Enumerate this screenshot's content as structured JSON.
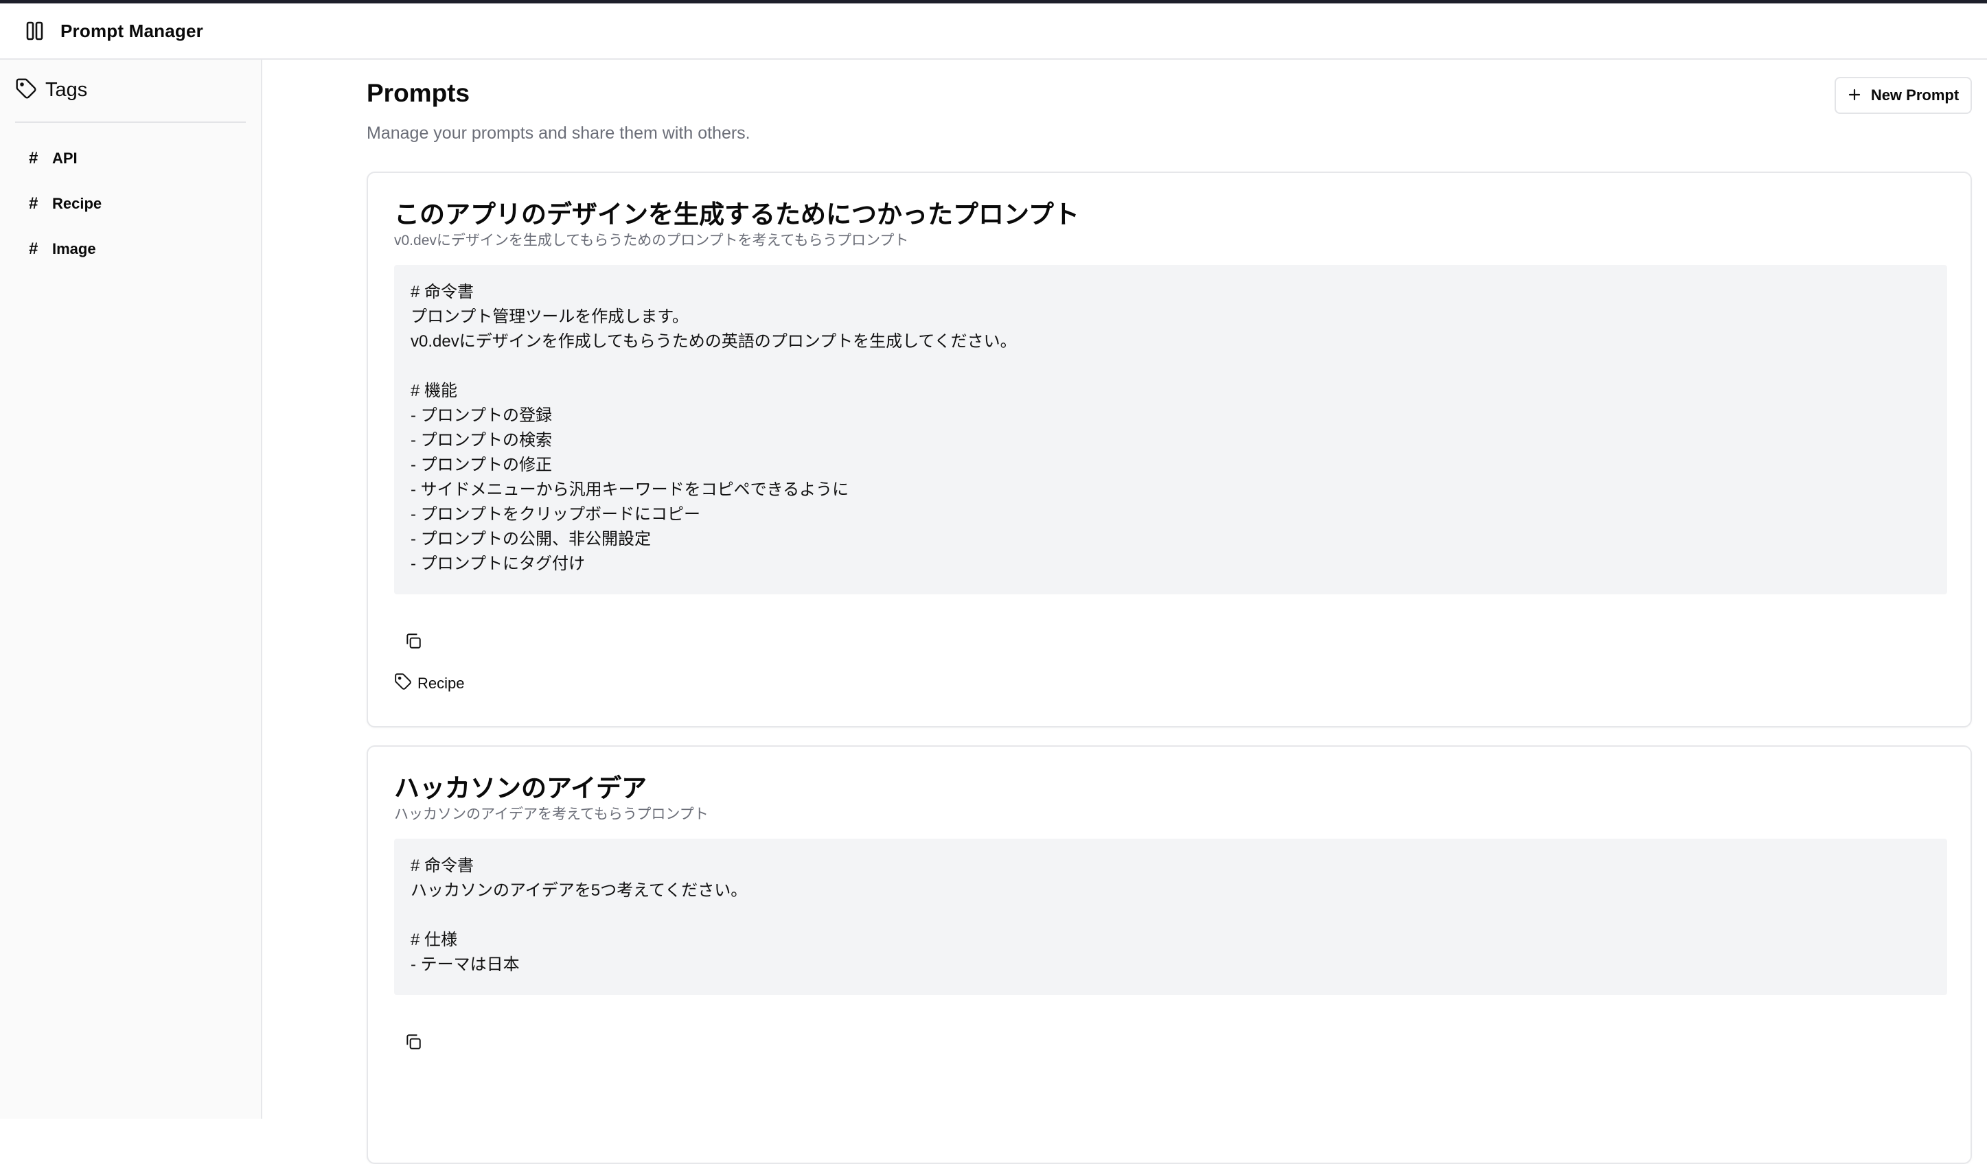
{
  "app": {
    "title": "Prompt Manager"
  },
  "sidebar": {
    "heading": "Tags",
    "items": [
      {
        "hash": "#",
        "label": "API"
      },
      {
        "hash": "#",
        "label": "Recipe"
      },
      {
        "hash": "#",
        "label": "Image"
      }
    ]
  },
  "main": {
    "title": "Prompts",
    "subtitle": "Manage your prompts and share them with others.",
    "new_button": {
      "icon": "plus-icon",
      "label": "New Prompt"
    }
  },
  "prompts": [
    {
      "title": "このアプリのデザインを生成するためにつかったプロンプト",
      "description": "v0.devにデザインを生成してもらうためのプロンプトを考えてもらうプロンプト",
      "body": "# 命令書\nプロンプト管理ツールを作成します。\nv0.devにデザインを作成してもらうための英語のプロンプトを生成してください。\n\n# 機能\n- プロンプトの登録\n- プロンプトの検索\n- プロンプトの修正\n- サイドメニューから汎用キーワードをコピペできるように\n- プロンプトをクリップボードにコピー\n- プロンプトの公開、非公開設定\n- プロンプトにタグ付け",
      "tag": "Recipe"
    },
    {
      "title": "ハッカソンのアイデア",
      "description": "ハッカソンのアイデアを考えてもらうプロンプト",
      "body": "# 命令書\nハッカソンのアイデアを5つ考えてください。\n\n# 仕様\n- テーマは日本"
    }
  ]
}
